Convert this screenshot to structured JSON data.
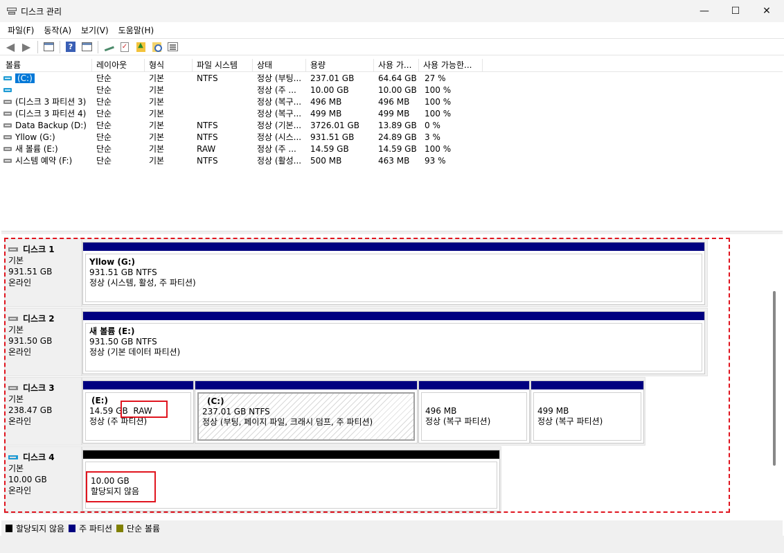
{
  "window": {
    "title": "디스크 관리",
    "controls": {
      "minimize": "—",
      "maximize": "☐",
      "close": "✕"
    }
  },
  "menu": [
    "파일(F)",
    "동작(A)",
    "보기(V)",
    "도움말(H)"
  ],
  "toolbar": {
    "icons": [
      "back-arrow-icon",
      "forward-arrow-icon",
      "console-tree-icon",
      "help-icon",
      "properties-icon",
      "connect-drive-icon",
      "check-icon",
      "up-folder-icon",
      "search-icon",
      "list-icon"
    ]
  },
  "volume_table": {
    "columns": [
      "볼륨",
      "레이아웃",
      "형식",
      "파일 시스템",
      "상태",
      "용량",
      "사용 가...",
      "사용 가능한..."
    ],
    "rows": [
      {
        "icon": "blue",
        "name": "(C:)",
        "layout": "단순",
        "type": "기본",
        "fs": "NTFS",
        "status": "정상 (부팅...",
        "capacity": "237.01 GB",
        "free": "64.64 GB",
        "pct": "27 %"
      },
      {
        "icon": "blue",
        "name": "",
        "layout": "단순",
        "type": "기본",
        "fs": "",
        "status": "정상 (주 ...",
        "capacity": "10.00 GB",
        "free": "10.00 GB",
        "pct": "100 %"
      },
      {
        "icon": "gray",
        "name": "(디스크 3 파티션 3)",
        "layout": "단순",
        "type": "기본",
        "fs": "",
        "status": "정상 (복구...",
        "capacity": "496 MB",
        "free": "496 MB",
        "pct": "100 %"
      },
      {
        "icon": "gray",
        "name": "(디스크 3 파티션 4)",
        "layout": "단순",
        "type": "기본",
        "fs": "",
        "status": "정상 (복구...",
        "capacity": "499 MB",
        "free": "499 MB",
        "pct": "100 %"
      },
      {
        "icon": "gray",
        "name": "Data Backup (D:)",
        "layout": "단순",
        "type": "기본",
        "fs": "NTFS",
        "status": "정상 (기본...",
        "capacity": "3726.01 GB",
        "free": "13.89 GB",
        "pct": "0 %"
      },
      {
        "icon": "gray",
        "name": "Yllow (G:)",
        "layout": "단순",
        "type": "기본",
        "fs": "NTFS",
        "status": "정상 (시스...",
        "capacity": "931.51 GB",
        "free": "24.89 GB",
        "pct": "3 %"
      },
      {
        "icon": "gray",
        "name": "새 볼륨 (E:)",
        "layout": "단순",
        "type": "기본",
        "fs": "RAW",
        "status": "정상 (주 ...",
        "capacity": "14.59 GB",
        "free": "14.59 GB",
        "pct": "100 %"
      },
      {
        "icon": "gray",
        "name": "시스템 예약 (F:)",
        "layout": "단순",
        "type": "기본",
        "fs": "NTFS",
        "status": "정상 (활성...",
        "capacity": "500 MB",
        "free": "463 MB",
        "pct": "93 %"
      }
    ]
  },
  "disks": [
    {
      "name": "디스크 1",
      "type": "기본",
      "size": "931.51 GB",
      "status": "온라인",
      "partitions": [
        {
          "name": "Yllow  (G:)",
          "size": "931.51 GB NTFS",
          "status": "정상 (시스템, 활성, 주 파티션)"
        }
      ]
    },
    {
      "name": "디스크 2",
      "type": "기본",
      "size": "931.50 GB",
      "status": "온라인",
      "partitions": [
        {
          "name": "새 볼륨  (E:)",
          "size": "931.50 GB NTFS",
          "status": "정상 (기본 데이터 파티션)"
        }
      ]
    },
    {
      "name": "디스크 3",
      "type": "기본",
      "size": "238.47 GB",
      "status": "온라인",
      "partitions": [
        {
          "name": "(E:)",
          "size": "14.59 GB",
          "fs": "RAW",
          "status": "정상 (주 파티션)"
        },
        {
          "name": "(C:)",
          "size": "237.01 GB NTFS",
          "status": "정상 (부팅, 페이지 파일, 크래시 덤프, 주 파티션)"
        },
        {
          "name": "",
          "size": "496 MB",
          "status": "정상 (복구 파티션)"
        },
        {
          "name": "",
          "size": "499 MB",
          "status": "정상 (복구 파티션)"
        }
      ]
    },
    {
      "name": "디스크 4",
      "type": "기본",
      "size": "10.00 GB",
      "status": "온라인",
      "partitions": [
        {
          "size": "10.00 GB",
          "status": "할당되지 않음"
        }
      ]
    }
  ],
  "legend": [
    {
      "label": "할당되지 않음",
      "color": "#000000"
    },
    {
      "label": "주 파티션",
      "color": "#000080"
    },
    {
      "label": "단순 볼륨",
      "color": "#808000"
    }
  ]
}
